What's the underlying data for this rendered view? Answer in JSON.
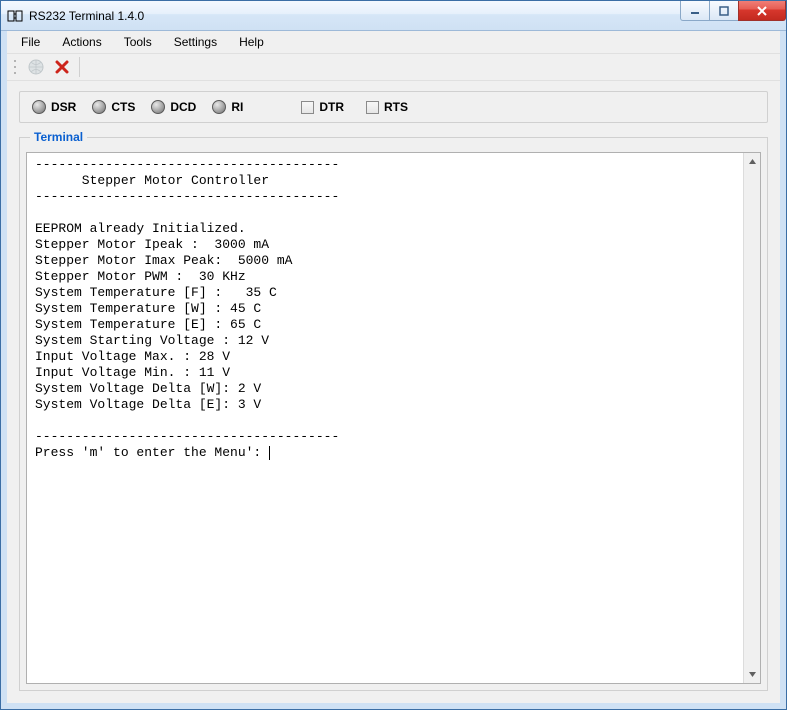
{
  "window": {
    "title": "RS232 Terminal 1.4.0"
  },
  "menu": {
    "file": "File",
    "actions": "Actions",
    "tools": "Tools",
    "settings": "Settings",
    "help": "Help"
  },
  "toolbar": {
    "globe": "connection-toggle",
    "close": "disconnect"
  },
  "status": {
    "dsr": "DSR",
    "cts": "CTS",
    "dcd": "DCD",
    "ri": "RI",
    "dtr": "DTR",
    "rts": "RTS"
  },
  "terminal": {
    "legend": "Terminal",
    "content": "---------------------------------------\n      Stepper Motor Controller\n---------------------------------------\n\nEEPROM already Initialized.\nStepper Motor Ipeak :  3000 mA\nStepper Motor Imax Peak:  5000 mA\nStepper Motor PWM :  30 KHz\nSystem Temperature [F] :   35 C\nSystem Temperature [W] : 45 C\nSystem Temperature [E] : 65 C\nSystem Starting Voltage : 12 V\nInput Voltage Max. : 28 V\nInput Voltage Min. : 11 V\nSystem Voltage Delta [W]: 2 V\nSystem Voltage Delta [E]: 3 V\n\n---------------------------------------\nPress 'm' to enter the Menu': "
  }
}
